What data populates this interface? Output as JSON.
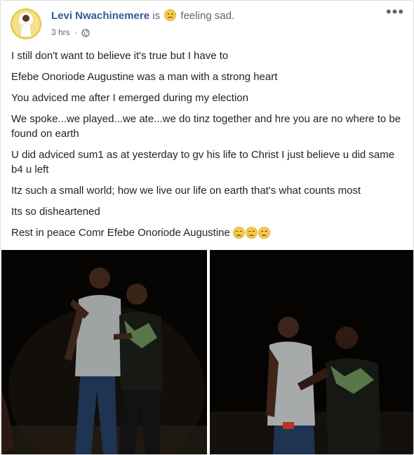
{
  "post": {
    "author": "Levi Nwachinemere",
    "is_word": "is",
    "feeling_emoji": "sad-face-emoji",
    "feeling_text": "feeling sad.",
    "time": "3 hrs",
    "separator": "·",
    "privacy_icon": "globe-icon",
    "more_icon": "more-options-icon",
    "more_label": "•••",
    "body": [
      "I still don't want to believe it's true but I have to",
      "Efebe Onoriode Augustine was a man with a strong heart",
      "You adviced me after I emerged during my election",
      "We spoke...we played...we ate...we do tinz together and hre you are no where to be found on earth",
      "U did adviced sum1 as at yesterday to gv his life to Christ I just believe u did same b4 u left",
      "Itz such a small world; how we live our life on earth that's what counts most",
      "Its so disheartened",
      "Rest in peace Comr Efebe Onoriode Augustine"
    ],
    "last_line_emojis": [
      "crying-face-emoji",
      "crying-face-emoji",
      "crying-face-emoji"
    ],
    "photos": [
      {
        "name": "photo-two-young-men-posing-night-1"
      },
      {
        "name": "photo-two-young-men-talking-night-2"
      }
    ]
  },
  "colors": {
    "author": "#385898",
    "meta": "#616770",
    "text": "#1d2129",
    "border": "#dddfe2",
    "emoji_yellow": "#f7c94a"
  }
}
